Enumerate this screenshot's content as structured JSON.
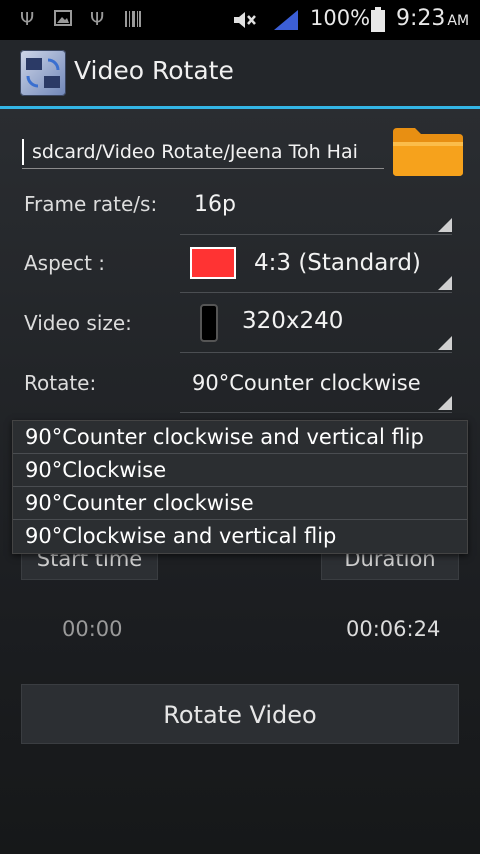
{
  "status_bar": {
    "battery_percent": "100%",
    "time": "9:23",
    "ampm": "AM"
  },
  "app": {
    "title": "Video Rotate"
  },
  "path": {
    "value": "sdcard/Video Rotate/Jeena Toh Hai"
  },
  "settings": {
    "frame_rate_label": "Frame rate/s:",
    "frame_rate_value": "16p",
    "aspect_label": "Aspect :",
    "aspect_value": "4:3 (Standard)",
    "aspect_color": "#ff3333",
    "video_size_label": "Video size:",
    "video_size_value": "320x240",
    "rotate_label": "Rotate:",
    "rotate_value": "90°Counter clockwise"
  },
  "rotate_options": [
    "90°Counter clockwise and vertical flip",
    "90°Clockwise",
    "90°Counter clockwise",
    "90°Clockwise and vertical flip"
  ],
  "time": {
    "start_label": "Start time",
    "duration_label": "Duration",
    "start_value": "00:00",
    "duration_value": "00:06:24"
  },
  "actions": {
    "rotate_button": "Rotate Video"
  },
  "colors": {
    "accent": "#33b5e5",
    "folder": "#f6a21c"
  }
}
